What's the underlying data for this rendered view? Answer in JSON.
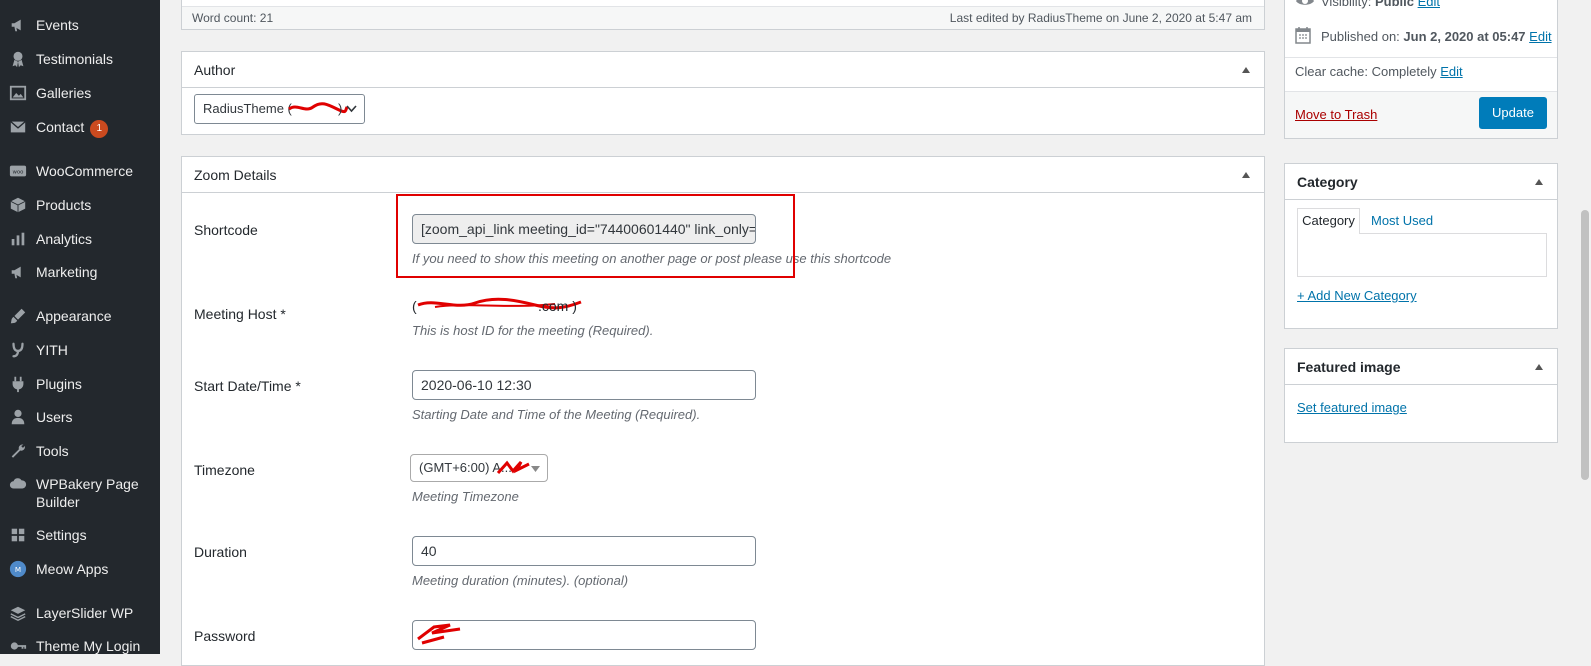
{
  "sidebar": {
    "items": [
      {
        "label": "Events",
        "icon": "megaphone-icon"
      },
      {
        "label": "Testimonials",
        "icon": "award-icon"
      },
      {
        "label": "Galleries",
        "icon": "gallery-icon"
      },
      {
        "label": "Contact",
        "icon": "mail-icon",
        "badge": "1"
      },
      {
        "label": "WooCommerce",
        "icon": "woo-icon"
      },
      {
        "label": "Products",
        "icon": "box-icon"
      },
      {
        "label": "Analytics",
        "icon": "bar-chart-icon"
      },
      {
        "label": "Marketing",
        "icon": "megaphone-icon"
      },
      {
        "label": "Appearance",
        "icon": "brush-icon"
      },
      {
        "label": "YITH",
        "icon": "yith-icon"
      },
      {
        "label": "Plugins",
        "icon": "plug-icon"
      },
      {
        "label": "Users",
        "icon": "user-icon"
      },
      {
        "label": "Tools",
        "icon": "wrench-icon"
      },
      {
        "label": "WPBakery Page Builder",
        "icon": "cloud-icon"
      },
      {
        "label": "Settings",
        "icon": "settings-icon"
      },
      {
        "label": "Meow Apps",
        "icon": "meow-icon"
      },
      {
        "label": "LayerSlider WP",
        "icon": "layers-icon"
      },
      {
        "label": "Theme My Login",
        "icon": "key-icon"
      }
    ]
  },
  "editor_status": {
    "word_count": "Word count: 21",
    "last_edited": "Last edited by RadiusTheme on June 2, 2020 at 5:47 am"
  },
  "author_box": {
    "title": "Author",
    "selected": "RadiusTheme ("
  },
  "zoom_box": {
    "title": "Zoom Details",
    "shortcode": {
      "label": "Shortcode",
      "value": "[zoom_api_link meeting_id=\"74400601440\" link_only=",
      "desc": "If you need to show this meeting on another page or post please use this shortcode"
    },
    "host": {
      "label": "Meeting Host *",
      "value_prefix": "(",
      "value_suffix": ".com )",
      "desc": "This is host ID for the meeting (Required)."
    },
    "start": {
      "label": "Start Date/Time *",
      "value": "2020-06-10 12:30",
      "desc": "Starting Date and Time of the Meeting (Required)."
    },
    "timezone": {
      "label": "Timezone",
      "value": "(GMT+6:00) A...",
      "desc": "Meeting Timezone"
    },
    "duration": {
      "label": "Duration",
      "value": "40",
      "desc": "Meeting duration (minutes). (optional)"
    },
    "password": {
      "label": "Password"
    }
  },
  "publish_box": {
    "visibility_label": "Visibility: ",
    "visibility_value": "Public",
    "edit": "Edit",
    "published_label": "Published on: ",
    "published_value": "Jun 2, 2020 at 05:47",
    "clear_cache_label": "Clear cache: Completely",
    "trash": "Move to Trash",
    "update": "Update"
  },
  "category_box": {
    "title": "Category",
    "tabs": [
      "Category",
      "Most Used"
    ],
    "add_new": "+ Add New Category"
  },
  "featured_box": {
    "title": "Featured image",
    "set_link": "Set featured image"
  },
  "colors": {
    "sidebar_bg": "#23282d",
    "link": "#0073aa",
    "primary_button": "#007cba",
    "badge": "#ca4a1f",
    "highlight_border": "#e00000"
  }
}
